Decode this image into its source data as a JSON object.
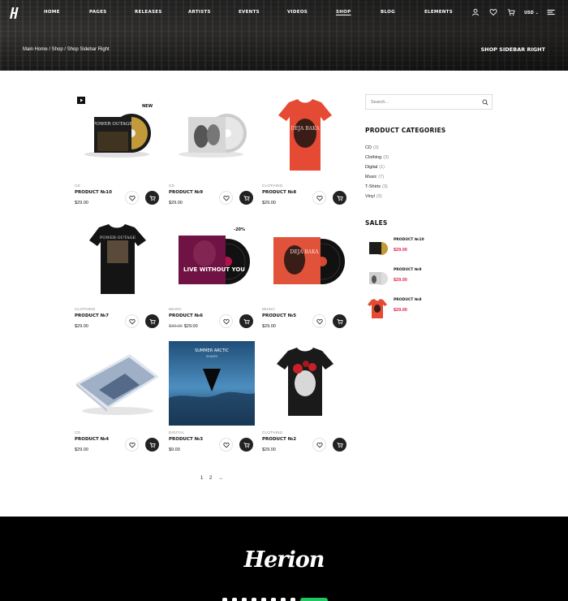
{
  "header": {
    "nav": [
      "Home",
      "Pages",
      "Releases",
      "Artists",
      "Events",
      "Videos",
      "Shop",
      "Blog",
      "Elements"
    ],
    "active_nav": "Shop",
    "currency": "USD",
    "breadcrumb": "Main Home / Shop / Shop Sidebar Right",
    "page_title": "Shop Sidebar Right"
  },
  "products": [
    {
      "category": "CD",
      "name": "Product №10",
      "price": "$29.00",
      "old_price": "",
      "badge": "New",
      "art": "cd-dark"
    },
    {
      "category": "CD",
      "name": "Product №9",
      "price": "$29.00",
      "old_price": "",
      "badge": "",
      "art": "cd-light"
    },
    {
      "category": "Clothing",
      "name": "Product №8",
      "price": "$29.00",
      "old_price": "",
      "badge": "",
      "art": "shirt-red"
    },
    {
      "category": "Clothing",
      "name": "Product №7",
      "price": "$29.00",
      "old_price": "",
      "badge": "",
      "art": "shirt-black"
    },
    {
      "category": "Music",
      "name": "Product №6",
      "price": "$29.00",
      "old_price": "$39.00",
      "badge": "-20%",
      "art": "vinyl-pink"
    },
    {
      "category": "Music",
      "name": "Product №5",
      "price": "$29.00",
      "old_price": "",
      "badge": "",
      "art": "vinyl-red"
    },
    {
      "category": "CD",
      "name": "Product №4",
      "price": "$29.00",
      "old_price": "",
      "badge": "",
      "art": "cd-case"
    },
    {
      "category": "Digital",
      "name": "Product №3",
      "price": "$9.00",
      "old_price": "",
      "badge": "",
      "art": "digital"
    },
    {
      "category": "Clothing",
      "name": "Product №2",
      "price": "$29.00",
      "old_price": "",
      "badge": "",
      "art": "shirt-heart"
    }
  ],
  "album_text": {
    "cd_dark": "POWER OUTAGE",
    "shirt_red": "DEJA BAKA",
    "shirt_black": "POWER OUTAGE",
    "vinyl_pink": "LIVE WITHOUT YOU",
    "vinyl_red": "DEJA BAKA",
    "digital_artist": "SUMMER ARCTIC",
    "digital_title": "SHADES"
  },
  "sidebar": {
    "search_placeholder": "Search...",
    "categories_title": "Product Categories",
    "categories": [
      {
        "label": "CD",
        "count": "(3)"
      },
      {
        "label": "Clothing",
        "count": "(3)"
      },
      {
        "label": "Digital",
        "count": "(1)"
      },
      {
        "label": "Music",
        "count": "(7)"
      },
      {
        "label": "T-Shirts",
        "count": "(3)"
      },
      {
        "label": "Vinyl",
        "count": "(3)"
      }
    ],
    "sales_title": "Sales",
    "sales": [
      {
        "name": "Product №10",
        "price": "$29.00",
        "art": "cd-dark"
      },
      {
        "name": "Product №9",
        "price": "$29.00",
        "art": "cd-light"
      },
      {
        "name": "Product №8",
        "price": "$29.00",
        "art": "shirt-red"
      }
    ]
  },
  "pagination": {
    "pages": [
      "1",
      "2"
    ],
    "next": "→"
  },
  "footer": {
    "logo": "Herion"
  },
  "colors": {
    "accent_price": "#e11d48",
    "dark": "#222222",
    "footer_bg": "#000000"
  },
  "icons": [
    "user-icon",
    "heart-icon",
    "cart-icon",
    "menu-icon",
    "search-icon",
    "play-icon"
  ]
}
